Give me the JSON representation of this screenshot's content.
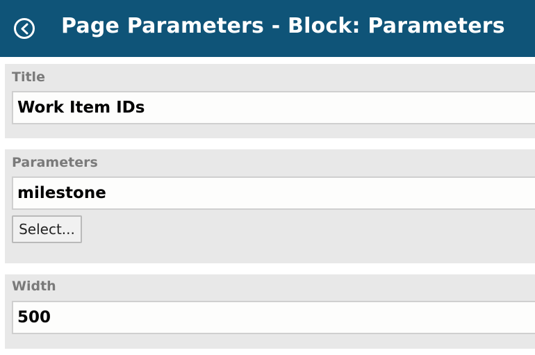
{
  "header": {
    "title": "Page Parameters - Block: Parameters",
    "back_icon": "back-arrow-circle-icon",
    "background_color": "#0f5478"
  },
  "fields": {
    "title": {
      "label": "Title",
      "value": "Work Item IDs"
    },
    "parameters": {
      "label": "Parameters",
      "value": "milestone",
      "select_label": "Select..."
    },
    "width": {
      "label": "Width",
      "value": "500"
    }
  }
}
